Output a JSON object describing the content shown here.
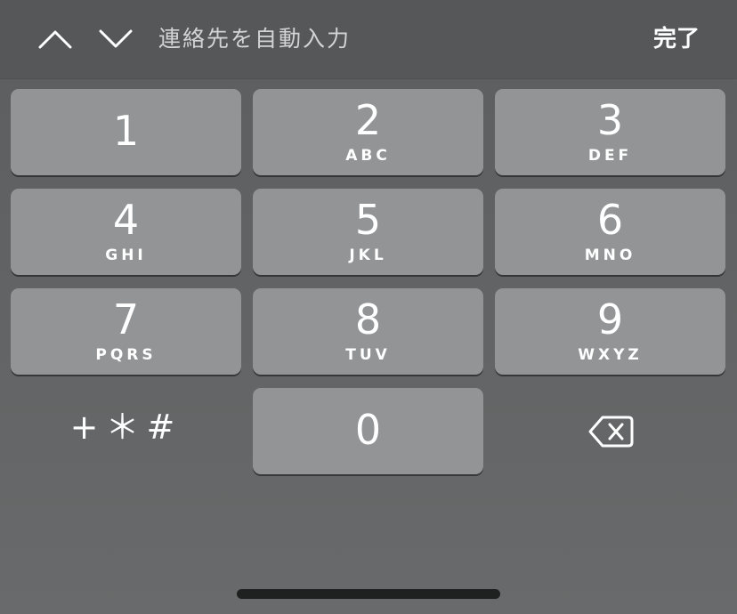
{
  "toolbar": {
    "autofill_label": "連絡先を自動入力",
    "done_label": "完了",
    "prev_icon": "chevron-up-icon",
    "next_icon": "chevron-down-icon"
  },
  "keypad": {
    "keys": [
      {
        "digit": "1",
        "letters": ""
      },
      {
        "digit": "2",
        "letters": "ABC"
      },
      {
        "digit": "3",
        "letters": "DEF"
      },
      {
        "digit": "4",
        "letters": "GHI"
      },
      {
        "digit": "5",
        "letters": "JKL"
      },
      {
        "digit": "6",
        "letters": "MNO"
      },
      {
        "digit": "7",
        "letters": "PQRS"
      },
      {
        "digit": "8",
        "letters": "TUV"
      },
      {
        "digit": "9",
        "letters": "WXYZ"
      },
      {
        "digit": "0",
        "letters": ""
      }
    ],
    "symbols_label": "+＊#",
    "delete_icon": "backspace-icon"
  },
  "colors": {
    "key_background": "#929495",
    "toolbar_background": "#555759",
    "keyboard_background": "#626465",
    "text": "#ffffff"
  }
}
